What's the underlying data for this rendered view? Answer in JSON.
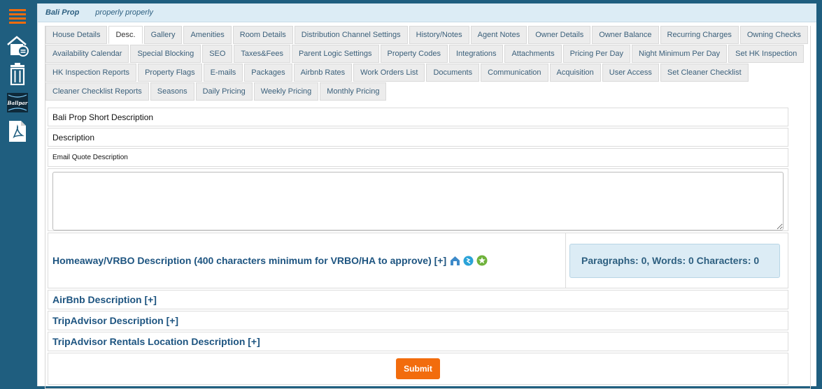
{
  "header": {
    "property_name": "Bali Prop",
    "subtitle": "properly properly"
  },
  "tabs": {
    "row1": [
      "House Details",
      "Desc.",
      "Gallery",
      "Amenities",
      "Room Details",
      "Distribution Channel Settings",
      "History/Notes",
      "Agent Notes",
      "Owner Details",
      "Owner Balance",
      "Recurring Charges",
      "Owning Checks"
    ],
    "row2": [
      "Availability Calendar",
      "Special Blocking",
      "SEO",
      "Taxes&Fees",
      "Parent Logic Settings",
      "Property Codes",
      "Integrations",
      "Attachments",
      "Pricing Per Day",
      "Night Minimum Per Day",
      "Set HK Inspection"
    ],
    "row3": [
      "HK Inspection Reports",
      "Property Flags",
      "E-mails",
      "Packages",
      "Airbnb Rates",
      "Work Orders List",
      "Documents",
      "Communication",
      "Acquisition",
      "User Access",
      "Set Cleaner Checklist"
    ],
    "row4": [
      "Cleaner Checklist Reports",
      "Seasons",
      "Daily Pricing",
      "Weekly Pricing",
      "Monthly Pricing"
    ],
    "active": "Desc."
  },
  "sections": {
    "short_description": "Bali Prop Short Description",
    "description": "Description",
    "email_quote": "Email Quote Description",
    "email_quote_value": "",
    "vrbo": "Homeaway/VRBO Description (400 characters minimum for VRBO/HA to approve) [+]",
    "counter": "Paragraphs: 0, Words: 0 Characters: 0",
    "airbnb": "AirBnb Description [+]",
    "tripadvisor": "TripAdvisor Description [+]",
    "tripadvisor_rentals": "TripAdvisor Rentals Location Description [+]"
  },
  "actions": {
    "submit_label": "Submit"
  },
  "sidebar": {
    "icons": [
      "menu-icon",
      "home-icon",
      "trash-icon",
      "ballpark-logo",
      "pdf-icon"
    ],
    "logo_text": "Ballpar"
  },
  "colors": {
    "sidebar": "#1f5e7f",
    "accent": "#f26c0d",
    "link": "#1d5480"
  }
}
